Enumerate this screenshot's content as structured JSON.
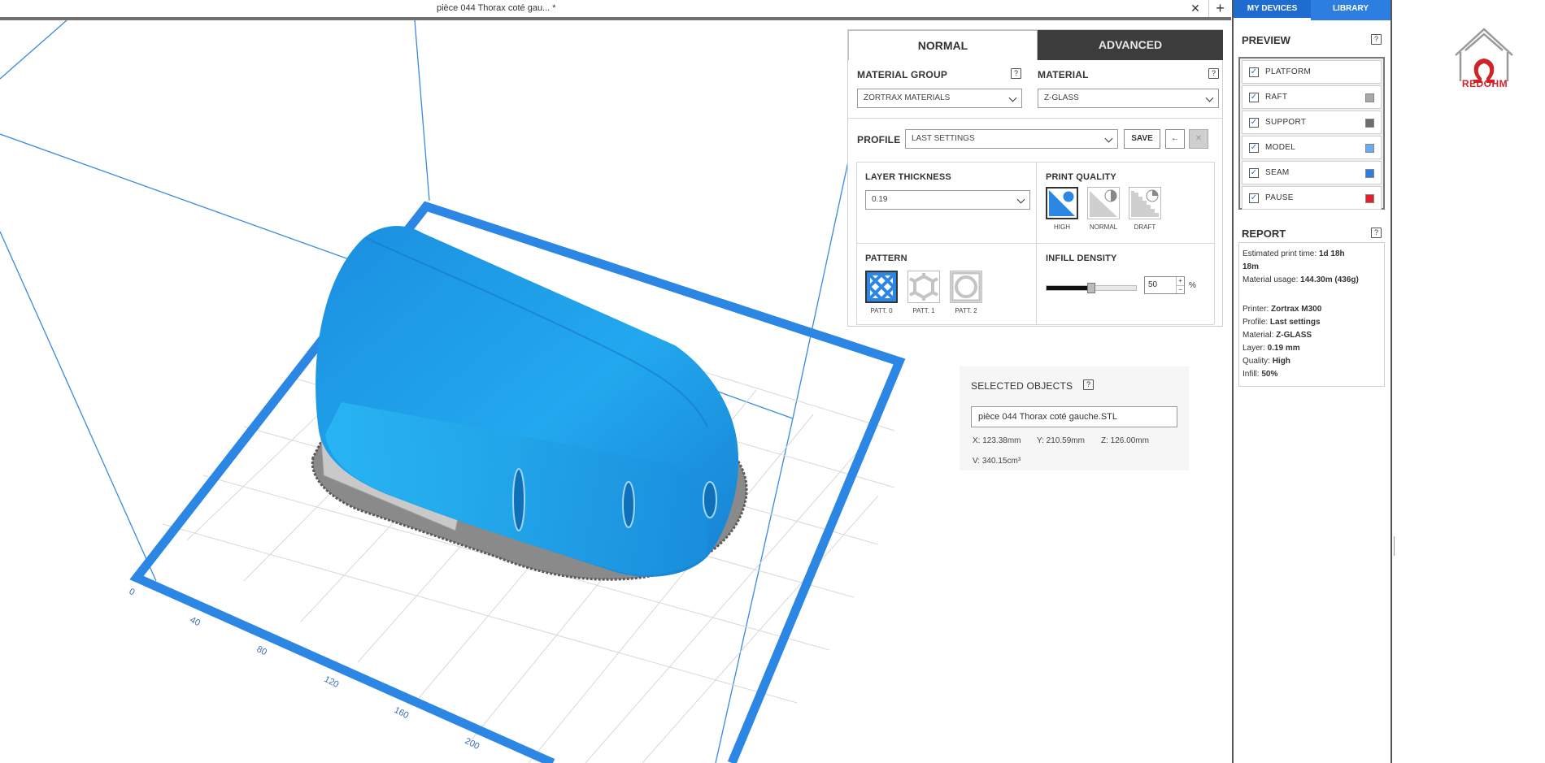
{
  "tab": {
    "title": "pièce 044 Thorax coté gau... *",
    "close": "✕",
    "add": "+"
  },
  "settings": {
    "tabs": {
      "normal": "NORMAL",
      "advanced": "ADVANCED"
    },
    "material_group": {
      "label": "MATERIAL GROUP",
      "value": "ZORTRAX MATERIALS"
    },
    "material": {
      "label": "MATERIAL",
      "value": "Z-GLASS"
    },
    "profile": {
      "label": "PROFILE",
      "value": "LAST SETTINGS",
      "save": "SAVE",
      "back": "←",
      "remove": "✕"
    },
    "layer_thickness": {
      "label": "LAYER THICKNESS",
      "value": "0.19"
    },
    "print_quality": {
      "label": "PRINT QUALITY",
      "options": [
        "HIGH",
        "NORMAL",
        "DRAFT"
      ],
      "selected": "HIGH"
    },
    "pattern": {
      "label": "PATTERN",
      "options": [
        "PATT. 0",
        "PATT. 1",
        "PATT. 2"
      ],
      "selected": "PATT. 0"
    },
    "infill_density": {
      "label": "INFILL DENSITY",
      "value": "50",
      "unit": "%",
      "fraction": 0.5,
      "up": "+",
      "down": "−"
    },
    "help": "?"
  },
  "selected_objects": {
    "label": "SELECTED OBJECTS",
    "name": "pièce 044 Thorax coté gauche.STL",
    "x": "X: 123.38mm",
    "y": "Y: 210.59mm",
    "z": "Z: 126.00mm",
    "v": "V: 340.15cm³"
  },
  "sidebar": {
    "tabs": {
      "devices": "MY DEVICES",
      "library": "LIBRARY"
    },
    "preview": {
      "label": "PREVIEW",
      "items": [
        {
          "label": "PLATFORM",
          "checked": true,
          "color": ""
        },
        {
          "label": "RAFT",
          "checked": true,
          "color": "#a8a8a8"
        },
        {
          "label": "SUPPORT",
          "checked": true,
          "color": "#6d6d6d"
        },
        {
          "label": "MODEL",
          "checked": true,
          "color": "#6aaaf0"
        },
        {
          "label": "SEAM",
          "checked": true,
          "color": "#2e7de0"
        },
        {
          "label": "PAUSE",
          "checked": true,
          "color": "#e0202a"
        }
      ]
    },
    "report": {
      "label": "REPORT",
      "time_label": "Estimated print time:",
      "time_value": "1d 18h",
      "time_value_cont": "18m",
      "material_label": "Material usage:",
      "material_value": "144.30m (436g)",
      "printer_label": "Printer:",
      "printer_value": "Zortrax M300",
      "profile_label": "Profile:",
      "profile_value": "Last settings",
      "mat_label": "Material:",
      "mat_value": "Z-GLASS",
      "layer_label": "Layer:",
      "layer_value": "0.19 mm",
      "quality_label": "Quality:",
      "quality_value": "High",
      "infill_label": "Infill:",
      "infill_value": "50%"
    }
  },
  "axis_ticks": [
    "0",
    "40",
    "80",
    "120",
    "160",
    "200"
  ],
  "logo": {
    "text": "REDOHM"
  },
  "colors": {
    "accent": "#2c7fe0",
    "model_blue": "#1ea0e6",
    "platform_blue": "#2b86e4",
    "dark_tab": "#3c3c3c",
    "logo_red": "#d0232a"
  }
}
